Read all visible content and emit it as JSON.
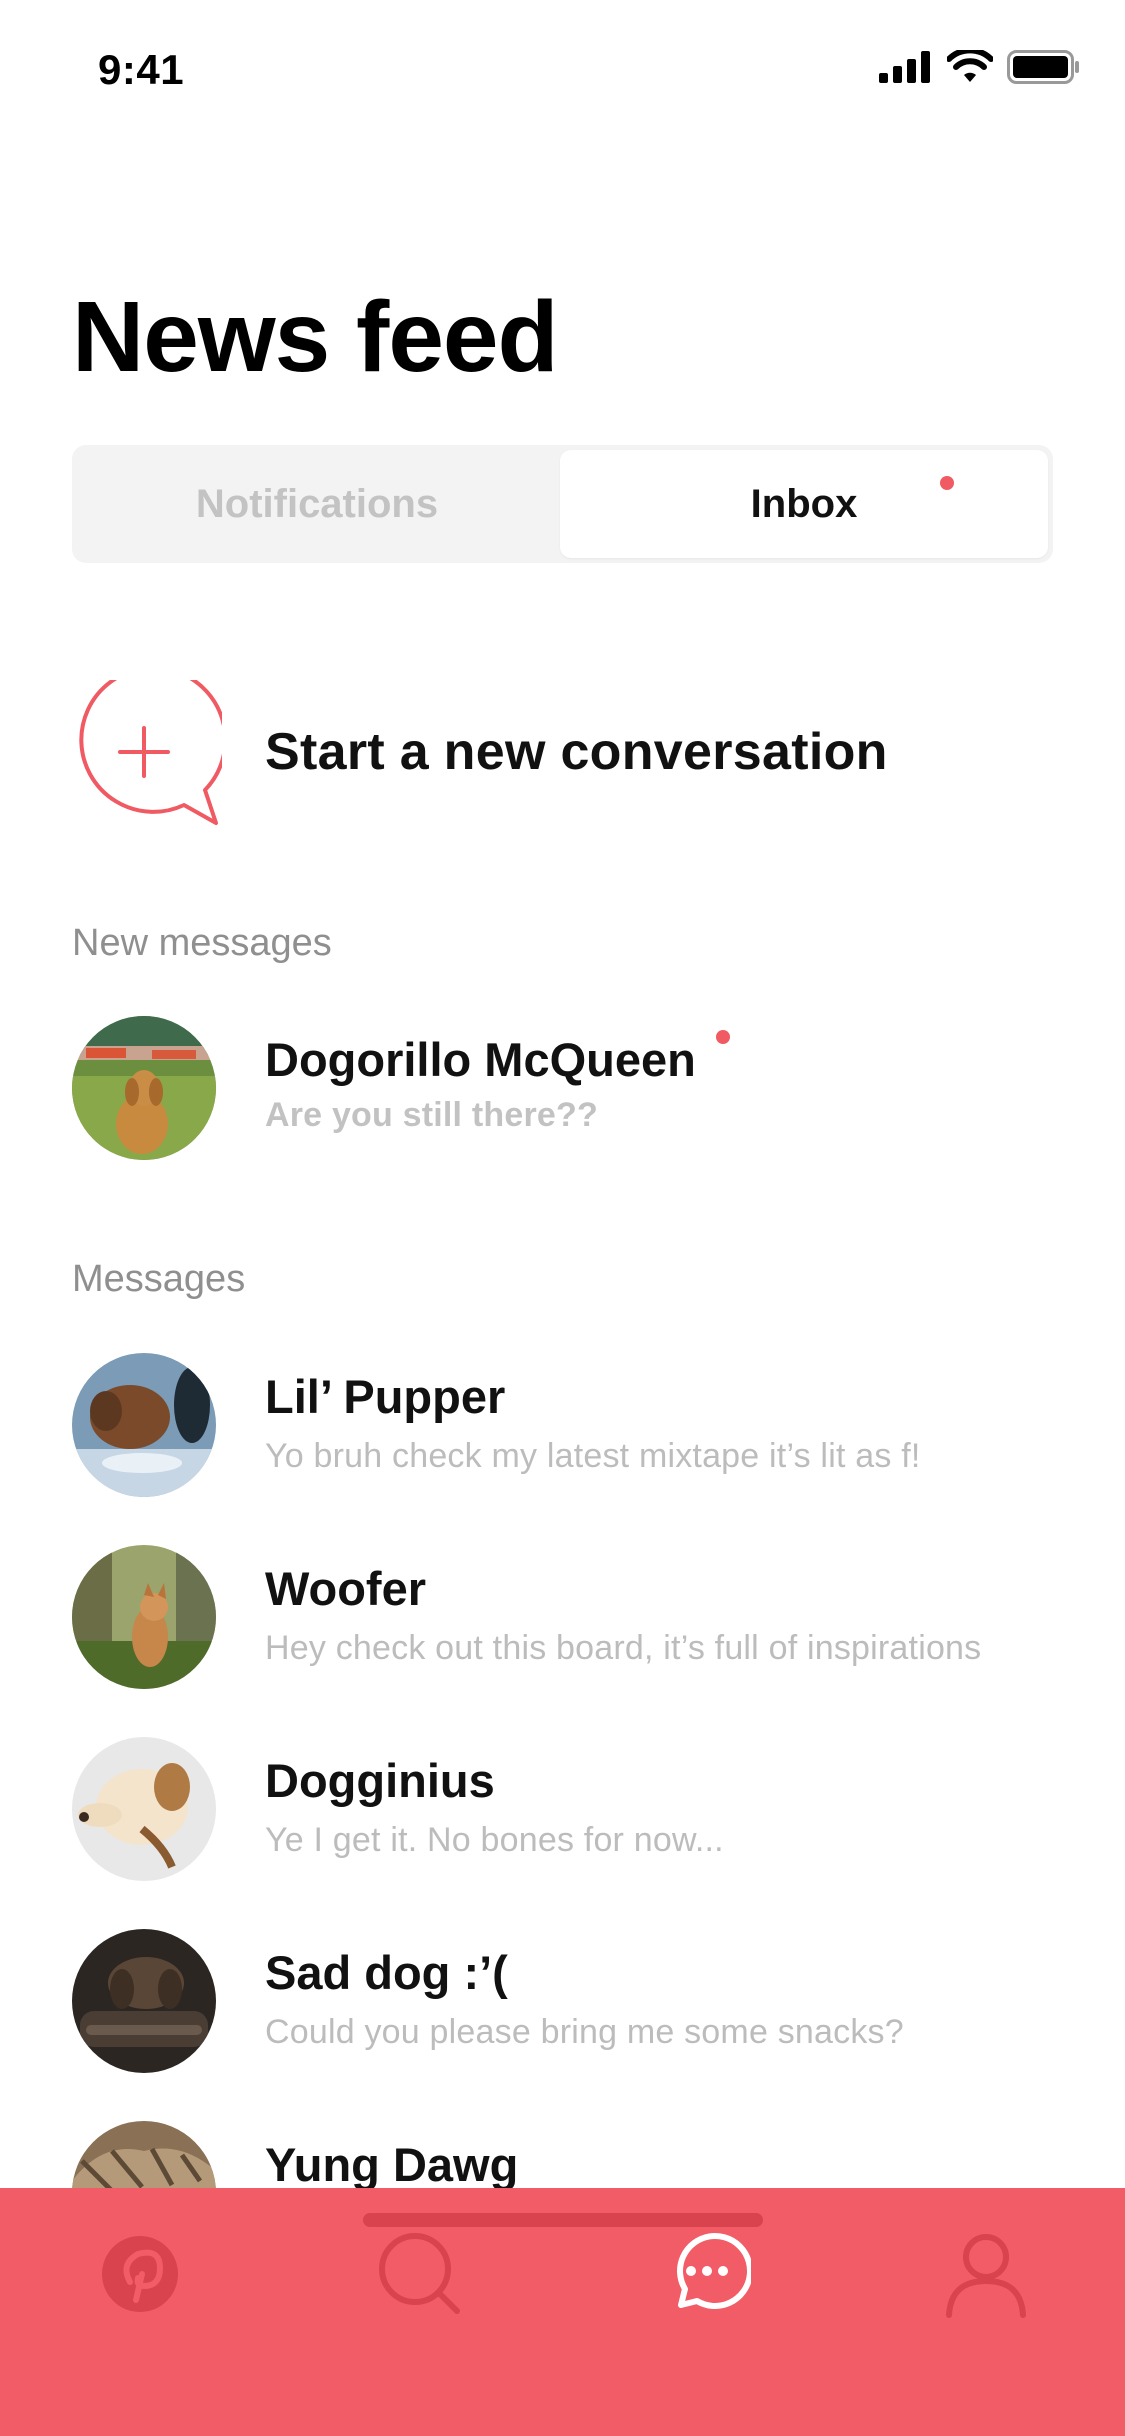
{
  "status_bar": {
    "time": "9:41"
  },
  "page": {
    "title": "News feed"
  },
  "segmented": {
    "notifications_label": "Notifications",
    "inbox_label": "Inbox"
  },
  "new_conversation": {
    "label": "Start a new conversation"
  },
  "sections": {
    "new_messages": "New messages",
    "messages": "Messages"
  },
  "new_messages": [
    {
      "name": "Dogorillo McQueen",
      "preview": "Are you still there??",
      "unread": true
    }
  ],
  "messages": [
    {
      "name": "Lil’ Pupper",
      "preview": "Yo bruh check my latest mixtape it’s lit as f!"
    },
    {
      "name": "Woofer",
      "preview": "Hey check out this board, it’s full of inspirations"
    },
    {
      "name": "Dogginius",
      "preview": "Ye I get it. No bones for now..."
    },
    {
      "name": "Sad dog :’(",
      "preview": "Could you please bring me some snacks?"
    },
    {
      "name": "Yung Dawg",
      "preview": ""
    }
  ],
  "tab_bar": {
    "items": [
      {
        "icon": "pinterest-icon",
        "active": false
      },
      {
        "icon": "search-icon",
        "active": false
      },
      {
        "icon": "chat-bubble-icon",
        "active": true
      },
      {
        "icon": "profile-icon",
        "active": false
      }
    ],
    "background_color": "#f25c66",
    "inactive_icon_color": "#d8434d",
    "active_icon_color": "#ffffff"
  },
  "colors": {
    "accent": "#ef5a63",
    "text": "#111111",
    "muted": "#8f8f8f",
    "preview": "#bcbcbc"
  }
}
